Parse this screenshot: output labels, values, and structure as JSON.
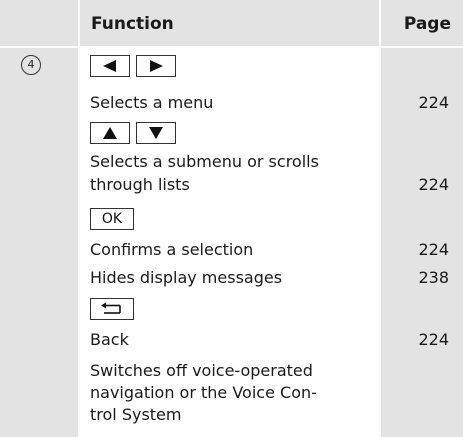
{
  "header": {
    "function_label": "Function",
    "page_label": "Page"
  },
  "row": {
    "number": "4",
    "icons": {
      "left": "arrow-left-icon",
      "right": "arrow-right-icon",
      "up": "arrow-up-icon",
      "down": "arrow-down-icon",
      "ok_label": "OK",
      "back": "back-icon"
    },
    "entries": [
      {
        "text": "Selects a menu",
        "page": "224"
      },
      {
        "text_lines": [
          "Selects a submenu or scrolls",
          "through lists"
        ],
        "page": "224"
      },
      {
        "text": "Confirms a selection",
        "page": "224"
      },
      {
        "text": "Hides display messages",
        "page": "238"
      },
      {
        "text": "Back",
        "page": "224"
      },
      {
        "text_lines": [
          "Switches off voice-operated",
          "navigation or the Voice Con-",
          "trol System"
        ],
        "page": ""
      }
    ]
  },
  "colors": {
    "shade": "#e3e3e3",
    "text": "#1a1a1a",
    "border": "#333333"
  }
}
